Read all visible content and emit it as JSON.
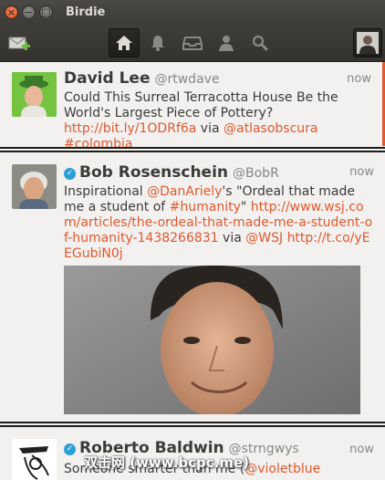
{
  "window": {
    "title": "Birdie"
  },
  "toolbar": {
    "compose_icon": "compose-icon",
    "tabs": [
      "home-icon",
      "mentions-icon",
      "inbox-icon",
      "profile-icon",
      "search-icon"
    ],
    "active_tab": "home-icon"
  },
  "tweets": [
    {
      "name": "David Lee",
      "handle": "@rtwdave",
      "time": "now",
      "text_1": "Could This Surreal Terracotta House Be the World's Largest Piece of Pottery? ",
      "link_1": "http://bit.ly/1ODRf6a",
      "text_2": " via ",
      "mention_1": "@atlasobscura",
      "text_3": " ",
      "hashtag_1": "#colombia"
    },
    {
      "name": "Bob Rosenschein",
      "verified": true,
      "handle": "@BobR",
      "time": "now",
      "text_1": "Inspirational ",
      "mention_1": "@DanAriely",
      "text_2": "'s \"Ordeal that made me a student of ",
      "hashtag_1": "#humanity",
      "text_3": "\" ",
      "link_1": "http://www.wsj.com/articles/the-ordeal-that-made-me-a-student-of-humanity-1438266831",
      "text_4": " via ",
      "mention_2": "@WSJ",
      "text_5": " ",
      "link_2": "http://t.co/yEEGubiN0j"
    },
    {
      "name": "Roberto Baldwin",
      "verified": true,
      "handle": "@strngwys",
      "time": "now",
      "text_1": "Someone smarter than me (",
      "mention_1": "@violetblue"
    }
  ],
  "watermark": "双击网 (www.bcpc.me)",
  "colors": {
    "link": "#e1582c",
    "verified": "#2a9fd6",
    "titlebar": "#3c3b37"
  }
}
